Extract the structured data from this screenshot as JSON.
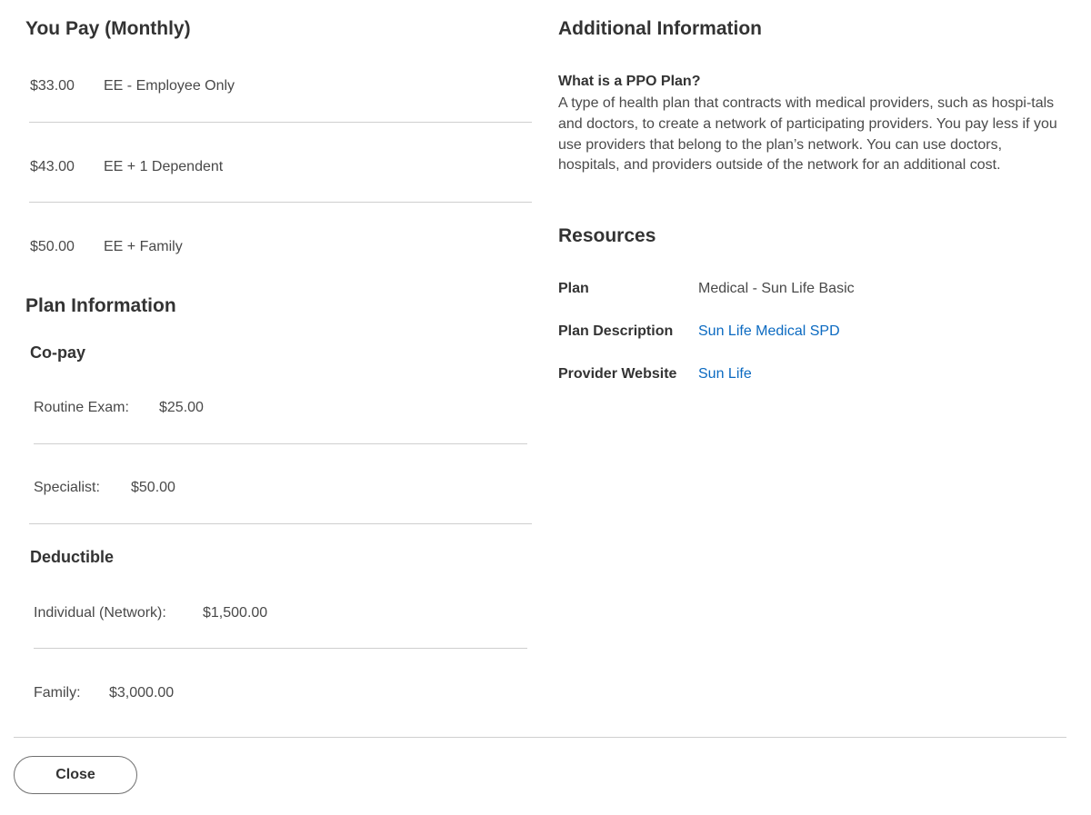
{
  "you_pay": {
    "title": "You Pay (Monthly)",
    "rows": [
      {
        "amount": "$33.00",
        "tier": "EE - Employee Only"
      },
      {
        "amount": "$43.00",
        "tier": "EE + 1 Dependent"
      },
      {
        "amount": "$50.00",
        "tier": "EE + Family"
      }
    ]
  },
  "plan_info": {
    "title": "Plan Information",
    "copay": {
      "title": "Co-pay",
      "rows": [
        {
          "label": "Routine Exam:",
          "value": "$25.00"
        },
        {
          "label": "Specialist:",
          "value": "$50.00"
        }
      ]
    },
    "deductible": {
      "title": "Deductible",
      "rows": [
        {
          "label": "Individual (Network):",
          "value": "$1,500.00"
        },
        {
          "label": "Family:",
          "value": "$3,000.00"
        }
      ]
    }
  },
  "additional": {
    "title": "Additional Information",
    "question": "What is a PPO Plan?",
    "answer": "A type of health plan that contracts with medical providers, such as hospi-tals and doctors, to create a network of participating providers. You pay less if you use providers that belong to the plan’s network. You can use doctors, hospitals, and providers outside of the network for an additional cost."
  },
  "resources": {
    "title": "Resources",
    "plan_label": "Plan",
    "plan_value": "Medical - Sun Life Basic",
    "description_label": "Plan Description",
    "description_link": "Sun Life Medical SPD",
    "website_label": "Provider Website",
    "website_link": "Sun Life"
  },
  "footer": {
    "close_label": "Close"
  },
  "colors": {
    "link": "#0b6ac1",
    "divider": "#cfcfcf",
    "heading": "#333333"
  }
}
